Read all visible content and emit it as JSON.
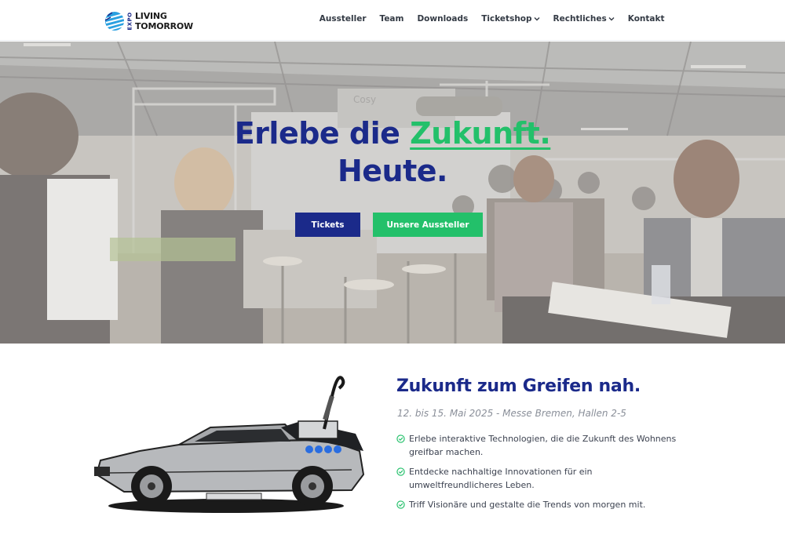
{
  "logo": {
    "expo": "EXPO",
    "line1": "LIVING",
    "line2": "TOMORROW"
  },
  "nav": {
    "items": [
      {
        "label": "Aussteller",
        "dropdown": false
      },
      {
        "label": "Team",
        "dropdown": false
      },
      {
        "label": "Downloads",
        "dropdown": false
      },
      {
        "label": "Ticketshop",
        "dropdown": true
      },
      {
        "label": "Rechtliches",
        "dropdown": true
      },
      {
        "label": "Kontakt",
        "dropdown": false
      }
    ]
  },
  "hero": {
    "title_part1": "Erlebe die ",
    "title_accent": "Zukunft.",
    "title_line2": "Heute.",
    "primary_button": "Tickets",
    "secondary_button": "Unsere Aussteller",
    "sign_text": "Cosy & Trendy"
  },
  "section": {
    "title": "Zukunft zum Greifen nah.",
    "subtitle": "12. bis 15. Mai 2025 - Messe Bremen, Hallen 2-5",
    "features": [
      "Erlebe interaktive Technologien, die die Zukunft des Wohnens greifbar machen.",
      "Entdecke nachhaltige Innovationen für ein umweltfreundlicheres Leben.",
      "Triff Visionäre und gestalte die Trends von morgen mit."
    ]
  },
  "colors": {
    "brand_blue": "#1b2a8a",
    "accent_green": "#23c06a",
    "logo_blue": "#2aa0e0"
  },
  "icons": {
    "check": "check-circle-icon",
    "chevron": "chevron-down-icon"
  }
}
